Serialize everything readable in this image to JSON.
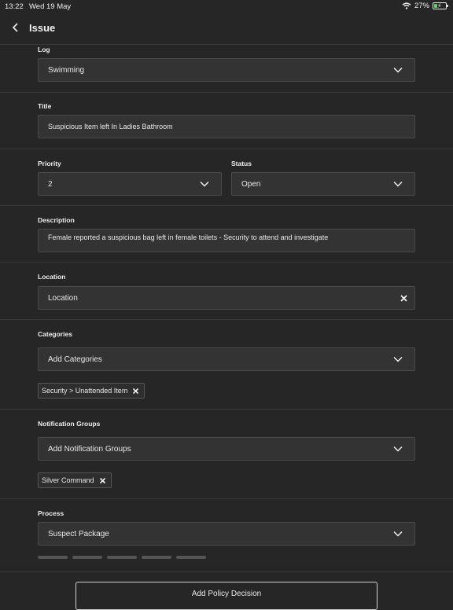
{
  "status_bar": {
    "time": "13:22",
    "date": "Wed 19 May",
    "battery": "27%"
  },
  "header": {
    "title": "Issue"
  },
  "log": {
    "label": "Log",
    "value": "Swimming"
  },
  "title_field": {
    "label": "Title",
    "value": "Suspicious Item left In Ladies Bathroom"
  },
  "priority": {
    "label": "Priority",
    "value": "2"
  },
  "status": {
    "label": "Status",
    "value": "Open"
  },
  "description": {
    "label": "Description",
    "value": "Female reported a suspicious bag left in female toilets - Security to attend and investigate"
  },
  "location": {
    "label": "Location",
    "placeholder": "Location"
  },
  "categories": {
    "label": "Categories",
    "placeholder": "Add Categories",
    "chips": [
      "Security > Unattended Item"
    ]
  },
  "notification_groups": {
    "label": "Notification Groups",
    "placeholder": "Add Notification Groups",
    "chips": [
      "Silver Command"
    ]
  },
  "process": {
    "label": "Process",
    "value": "Suspect Package"
  },
  "actions": {
    "add_policy_decision": "Add Policy Decision"
  }
}
